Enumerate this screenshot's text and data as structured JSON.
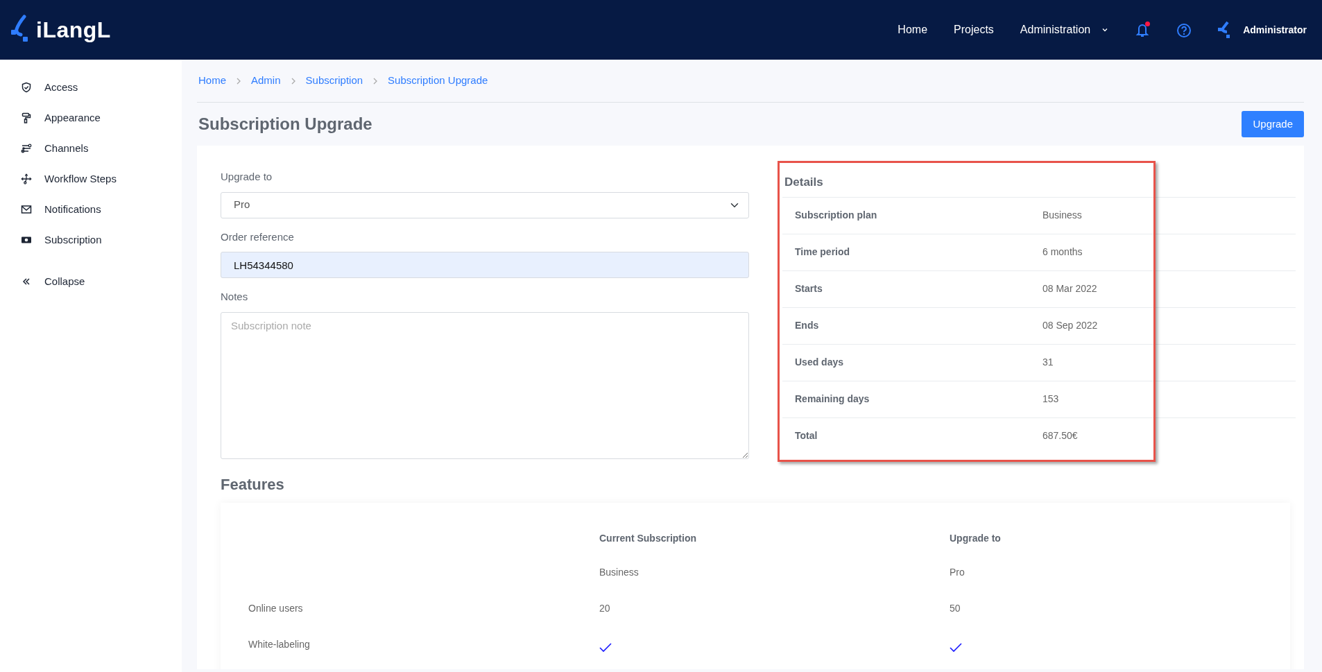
{
  "app": {
    "logo": "iLangL"
  },
  "nav": {
    "items": [
      {
        "label": "Home",
        "has_menu": false
      },
      {
        "label": "Projects",
        "has_menu": false
      },
      {
        "label": "Administration",
        "has_menu": true
      }
    ],
    "notifications": {
      "unread": true
    },
    "user": "Administrator"
  },
  "sidebar": {
    "items": [
      {
        "label": "Access"
      },
      {
        "label": "Appearance"
      },
      {
        "label": "Channels"
      },
      {
        "label": "Workflow Steps"
      },
      {
        "label": "Notifications"
      },
      {
        "label": "Subscription"
      }
    ],
    "collapse": "Collapse"
  },
  "breadcrumb": [
    "Home",
    "Admin",
    "Subscription",
    "Subscription Upgrade"
  ],
  "page": {
    "title": "Subscription Upgrade",
    "action": "Upgrade"
  },
  "form": {
    "upgrade_to": {
      "label": "Upgrade to",
      "value": "Pro"
    },
    "order_reference": {
      "label": "Order reference",
      "value": "LH54344580"
    },
    "notes": {
      "label": "Notes",
      "placeholder": "Subscription note"
    }
  },
  "details": {
    "title": "Details",
    "highlighted": true,
    "rows": [
      {
        "label": "Subscription plan",
        "value": "Business"
      },
      {
        "label": "Time period",
        "value": "6 months"
      },
      {
        "label": "Starts",
        "value": "08 Mar 2022"
      },
      {
        "label": "Ends",
        "value": "08 Sep 2022"
      },
      {
        "label": "Used days",
        "value": "31"
      },
      {
        "label": "Remaining days",
        "value": "153"
      },
      {
        "label": "Total",
        "value": "687.50€"
      }
    ]
  },
  "features": {
    "title": "Features",
    "columns": [
      "Current Subscription",
      "Upgrade to"
    ],
    "rows": [
      {
        "cells": [
          {
            "kind": "text",
            "text": "Business"
          },
          {
            "kind": "text",
            "text": "Pro"
          }
        ]
      },
      {
        "label": "Online users",
        "cells": [
          {
            "kind": "text",
            "text": "20"
          },
          {
            "kind": "text",
            "text": "50"
          }
        ]
      },
      {
        "label": "White-labeling",
        "cells": [
          {
            "kind": "check",
            "checked": true
          },
          {
            "kind": "check",
            "checked": true
          }
        ]
      }
    ]
  }
}
